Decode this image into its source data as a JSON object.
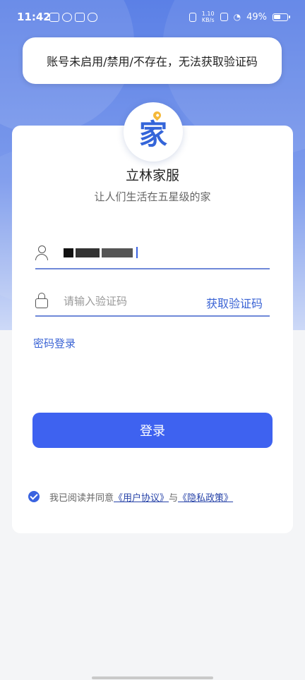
{
  "status_bar": {
    "time": "11:42",
    "net_speed_value": "1.10",
    "net_speed_unit": "KB/s",
    "battery": "49%"
  },
  "toast": {
    "message": "账号未启用/禁用/不存在，无法获取验证码"
  },
  "app": {
    "name": "立林家服",
    "slogan": "让人们生活在五星级的家",
    "logo_char": "家"
  },
  "form": {
    "code_placeholder": "请输入验证码",
    "get_code_label": "获取验证码",
    "password_login_label": "密码登录",
    "login_button": "登录"
  },
  "agreement": {
    "prefix": "我已阅读并同意",
    "user_agreement": "《用户协议》",
    "joiner": "与",
    "privacy_policy": "《隐私政策》",
    "checked": true
  },
  "colors": {
    "primary": "#3e62f0",
    "link": "#3a63d4",
    "header_gradient_top": "#5b80e6"
  }
}
